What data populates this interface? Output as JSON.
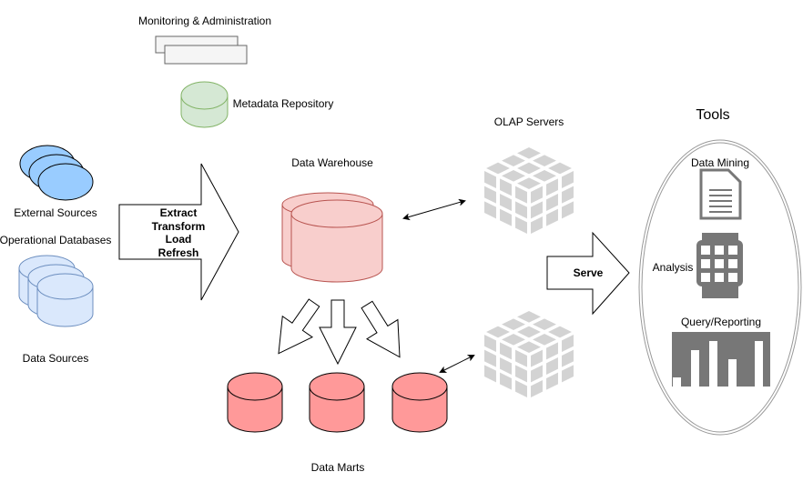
{
  "labels": {
    "monitoring": "Monitoring & Administration",
    "metadata": "Metadata Repository",
    "external_sources": "External Sources",
    "operational_databases": "Operational Databases",
    "data_sources": "Data Sources",
    "etl": [
      "Extract",
      "Transform",
      "Load",
      "Refresh"
    ],
    "data_warehouse": "Data Warehouse",
    "data_marts": "Data Marts",
    "olap_servers": "OLAP Servers",
    "serve": "Serve",
    "tools": "Tools",
    "data_mining": "Data Mining",
    "analysis": "Analysis",
    "query_reporting": "Query/Reporting"
  },
  "colors": {
    "external_sources": "#99ccff",
    "operational_databases": "#dae8fc",
    "metadata": "#d5e8d4",
    "data_warehouse": "#f8cecc",
    "data_marts": "#ff9999",
    "olap_cube": "#d3d3d3",
    "tool_icons": "#777777"
  },
  "icons": [
    "document-icon",
    "grid-icon",
    "bar-chart-icon",
    "olap-cube-icon",
    "database-icon"
  ]
}
